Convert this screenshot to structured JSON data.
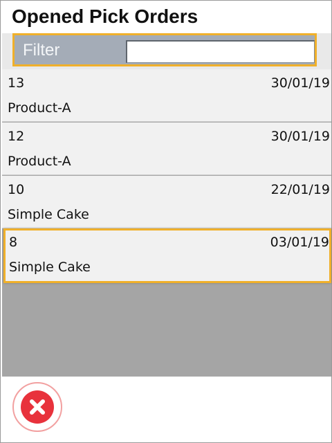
{
  "header": {
    "title": "Opened Pick Orders"
  },
  "filter": {
    "label": "Filter",
    "value": "",
    "placeholder": ""
  },
  "orders": [
    {
      "number": "13",
      "date": "30/01/19",
      "product": "Product-A",
      "selected": false
    },
    {
      "number": "12",
      "date": "30/01/19",
      "product": "Product-A",
      "selected": false
    },
    {
      "number": "10",
      "date": "22/01/19",
      "product": "Simple Cake",
      "selected": false
    },
    {
      "number": "8",
      "date": "03/01/19",
      "product": "Simple Cake",
      "selected": true
    }
  ],
  "footer": {
    "close_icon": "close-circle-icon"
  },
  "colors": {
    "accent": "#f0b02a",
    "close": "#e8323c",
    "filter_bg": "#a4acb7",
    "list_bg": "#a5a5a5"
  }
}
